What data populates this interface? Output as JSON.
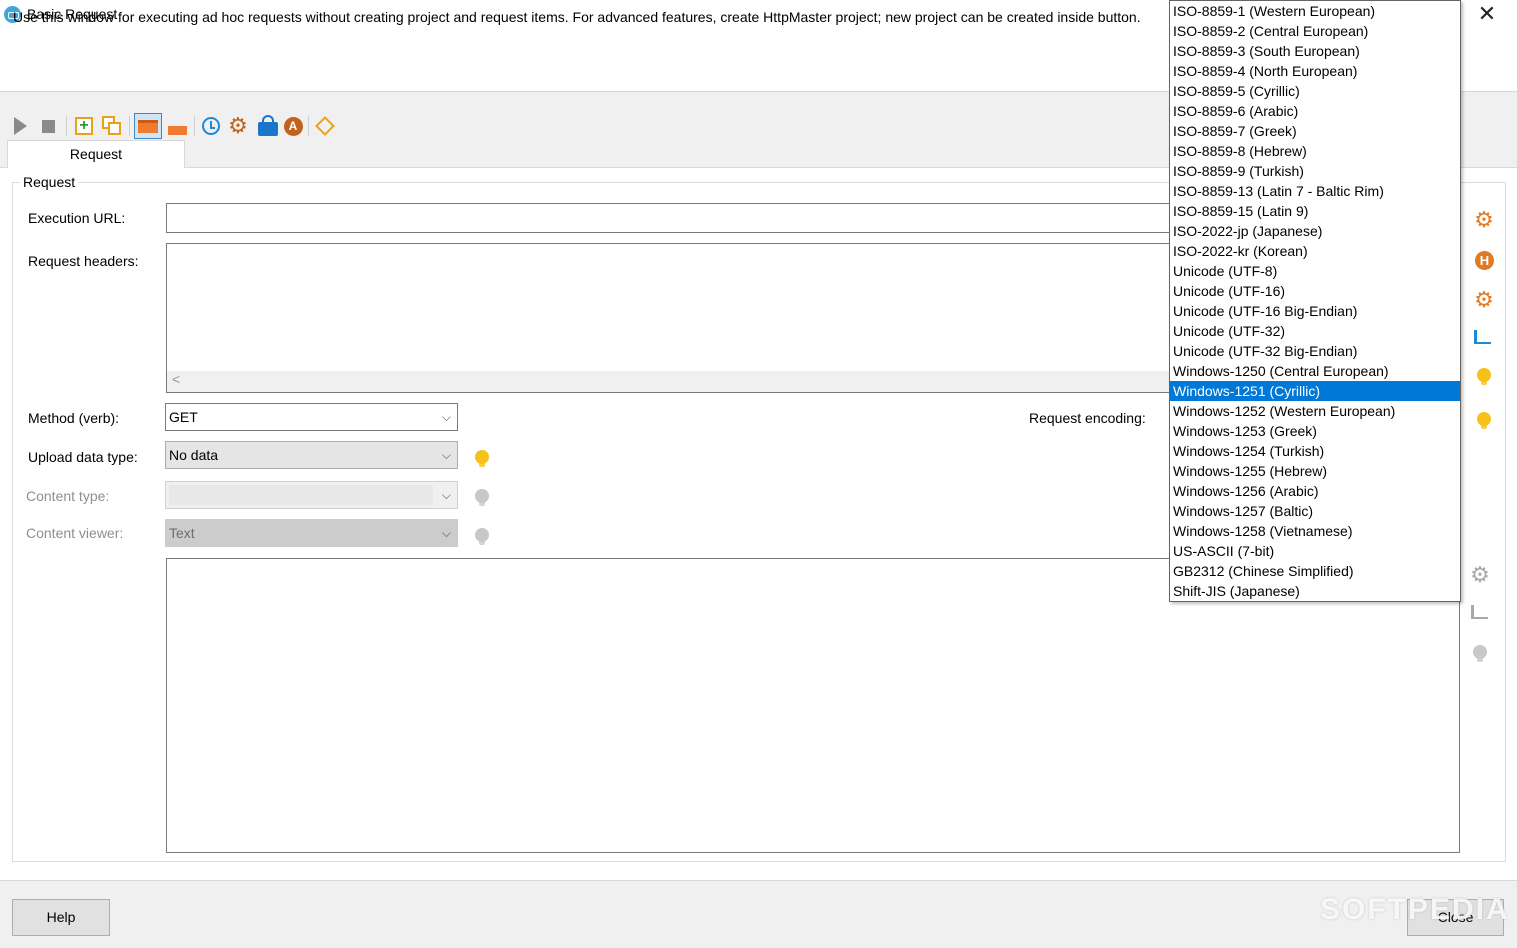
{
  "window": {
    "title": "Basic Request",
    "close_symbol": "✕",
    "description": "Use this window for executing ad hoc requests without creating project and request items. For advanced features, create HttpMaster project; new project can be created inside button."
  },
  "toolbar": {
    "icons": [
      "run-icon",
      "stop-icon",
      "add-icon",
      "copy-icon",
      "layout-horizontal-icon",
      "layout-collapsed-icon",
      "timer-icon",
      "settings-icon",
      "lock-icon",
      "auth-icon",
      "add-parameter-icon"
    ]
  },
  "tabs": [
    {
      "label": "Request"
    }
  ],
  "request": {
    "group_label": "Request",
    "url_label": "Execution URL:",
    "url_value": "",
    "headers_label": "Request headers:",
    "method_label": "Method (verb):",
    "method_value": "GET",
    "upload_label": "Upload data type:",
    "upload_value": "No data",
    "content_type_label": "Content type:",
    "content_type_value": "",
    "content_viewer_label": "Content viewer:",
    "content_viewer_value": "Text",
    "encoding_label": "Request encoding:"
  },
  "encoding_options": [
    "ISO-8859-1 (Western European)",
    "ISO-8859-2 (Central European)",
    "ISO-8859-3 (South European)",
    "ISO-8859-4 (North European)",
    "ISO-8859-5 (Cyrillic)",
    "ISO-8859-6 (Arabic)",
    "ISO-8859-7 (Greek)",
    "ISO-8859-8 (Hebrew)",
    "ISO-8859-9 (Turkish)",
    "ISO-8859-13 (Latin 7 - Baltic Rim)",
    "ISO-8859-15 (Latin 9)",
    "ISO-2022-jp (Japanese)",
    "ISO-2022-kr (Korean)",
    "Unicode (UTF-8)",
    "Unicode (UTF-16)",
    "Unicode (UTF-16 Big-Endian)",
    "Unicode (UTF-32)",
    "Unicode (UTF-32 Big-Endian)",
    "Windows-1250 (Central European)",
    "Windows-1251 (Cyrillic)",
    "Windows-1252 (Western European)",
    "Windows-1253 (Greek)",
    "Windows-1254 (Turkish)",
    "Windows-1255 (Hebrew)",
    "Windows-1256 (Arabic)",
    "Windows-1257 (Baltic)",
    "Windows-1258 (Vietnamese)",
    "US-ASCII (7-bit)",
    "GB2312 (Chinese Simplified)",
    "Shift-JIS (Japanese)"
  ],
  "encoding_selected": "Windows-1251 (Cyrillic)",
  "footer": {
    "help_label": "Help",
    "close_label": "Close",
    "watermark": "SOFTPEDIA"
  },
  "colors": {
    "selection": "#0078d7",
    "accent_orange": "#e07b24",
    "bulb_yellow": "#f6c21a"
  }
}
